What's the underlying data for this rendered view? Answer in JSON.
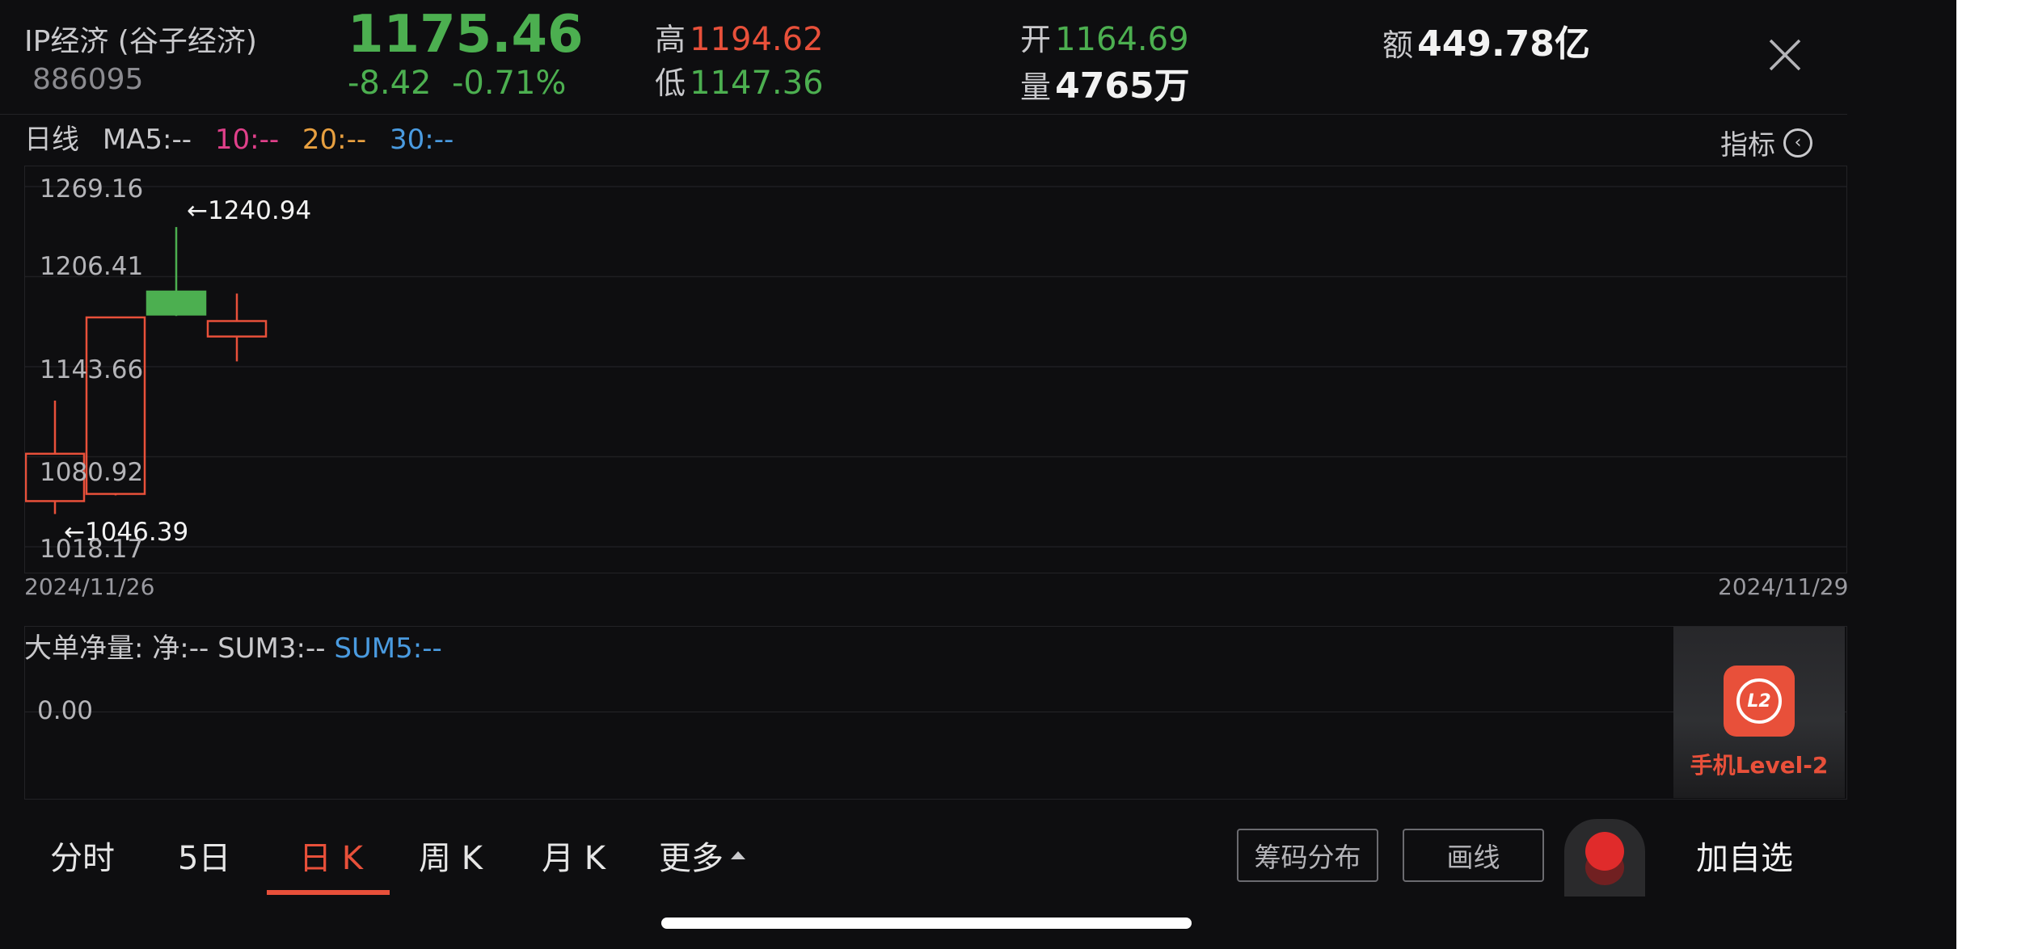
{
  "header": {
    "name": "IP经济 (谷子经济)",
    "code": "886095",
    "price": "1175.46",
    "change": "-8.42",
    "change_pct": "-0.71%",
    "high_label": "高",
    "high": "1194.62",
    "low_label": "低",
    "low": "1147.36",
    "open_label": "开",
    "open": "1164.69",
    "volume_label": "量",
    "volume": "4765万",
    "amount_label": "额",
    "amount": "449.78亿"
  },
  "ma_row": {
    "period": "日线",
    "ma5": "MA5:--",
    "ma10": "10:--",
    "ma20": "20:--",
    "ma30": "30:--",
    "indicator": "指标"
  },
  "chart_data": {
    "type": "candlestick",
    "y_ticks": [
      "1269.16",
      "1206.41",
      "1143.66",
      "1080.92",
      "1018.17"
    ],
    "ylim": [
      1018.17,
      1269.16
    ],
    "start_date": "2024/11/26",
    "end_date": "2024/11/29",
    "max_marker": "←1240.94",
    "min_marker": "←1046.39",
    "candles": [
      {
        "open": 1050,
        "close": 1083,
        "high": 1120,
        "low": 1041,
        "color": "red"
      },
      {
        "open": 1055,
        "close": 1178,
        "high": 1178,
        "low": 1054,
        "color": "red"
      },
      {
        "open": 1196,
        "close": 1180,
        "high": 1240.94,
        "low": 1179,
        "color": "green"
      },
      {
        "open": 1164.69,
        "close": 1175.46,
        "high": 1194.62,
        "low": 1147.36,
        "color": "red"
      }
    ]
  },
  "subchart": {
    "title": "大单净量:",
    "net": "净:--",
    "sum3": "SUM3:--",
    "sum5": "SUM5:--",
    "zero": "0.00"
  },
  "promo": {
    "label": "手机Level-2",
    "icon_text": "L2"
  },
  "tabs": [
    {
      "label": "分时"
    },
    {
      "label": "5日"
    },
    {
      "label": "日 K"
    },
    {
      "label": "周 K"
    },
    {
      "label": "月 K"
    },
    {
      "label": "更多"
    }
  ],
  "buttons": {
    "chips": "筹码分布",
    "draw": "画线",
    "add_watch": "加自选"
  },
  "colors": {
    "up": "#e8503a",
    "down": "#4caf50",
    "ma10": "#e0408a",
    "ma20": "#e8a040",
    "ma30": "#4a9be0",
    "background": "#0e0e10"
  }
}
